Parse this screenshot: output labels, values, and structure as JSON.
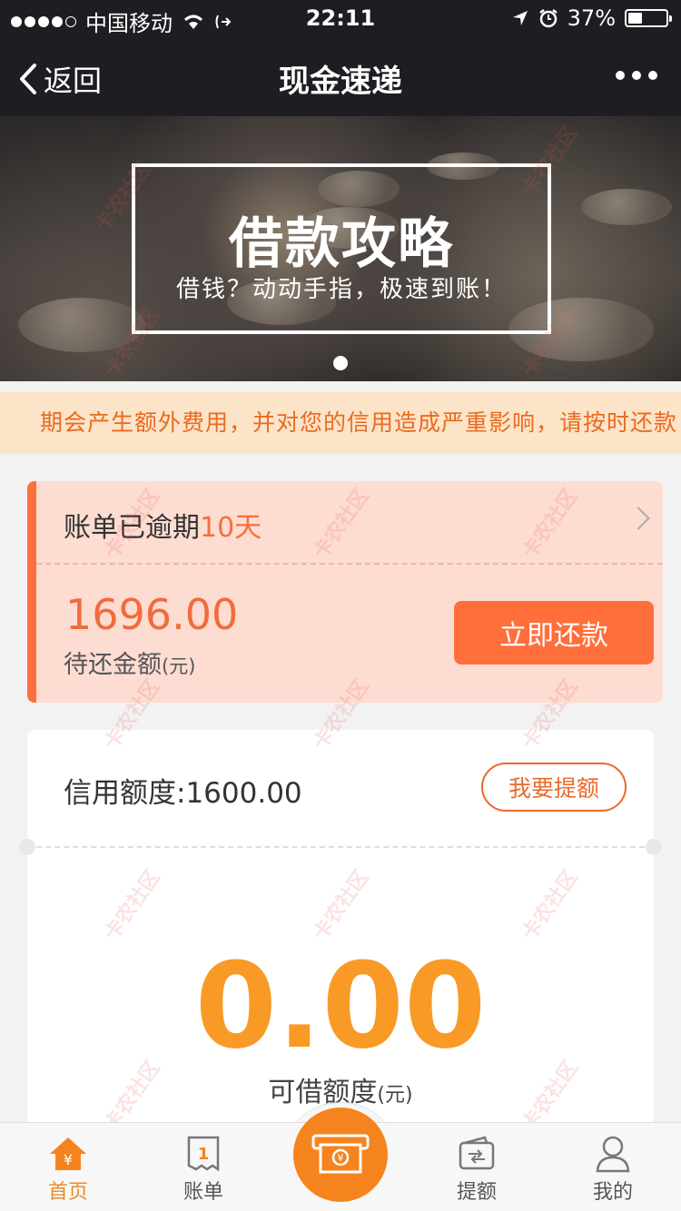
{
  "status_bar": {
    "carrier": "中国移动",
    "time": "22:11",
    "battery": "37%",
    "battery_level": 0.37
  },
  "nav": {
    "back_label": "返回",
    "title": "现金速递"
  },
  "banner": {
    "title": "借款攻略",
    "subtitle": "借钱？动动手指，极速到账！",
    "active_slide": 1,
    "slide_count": 1
  },
  "notice": {
    "text": "期会产生额外费用，并对您的信用造成严重影响，请按时还款"
  },
  "overdue_card": {
    "prefix": "账单已逾期",
    "days": "10天",
    "amount": "1696.00",
    "amount_label": "待还金额",
    "amount_unit": "(元)",
    "pay_button": "立即还款"
  },
  "credit_card": {
    "limit_text": "信用额度:1600.00",
    "raise_button": "我要提额",
    "available_amount": "0.00",
    "available_label": "可借额度",
    "available_unit": "(元)"
  },
  "tabbar": {
    "items": [
      {
        "label": "首页",
        "icon": "home-icon",
        "active": true
      },
      {
        "label": "账单",
        "icon": "bill-icon",
        "badge": "1"
      },
      {
        "label": "提额",
        "icon": "wallet-icon"
      },
      {
        "label": "我的",
        "icon": "user-icon"
      }
    ],
    "center_icon": "cash-icon"
  },
  "colors": {
    "accent": "#f5841f",
    "overdue_bg": "#fddcd1",
    "overdue_text": "#f26b3c",
    "header_bg": "#1e1d22",
    "notice_bg": "#fce4c8"
  },
  "watermark": "卡农社区"
}
